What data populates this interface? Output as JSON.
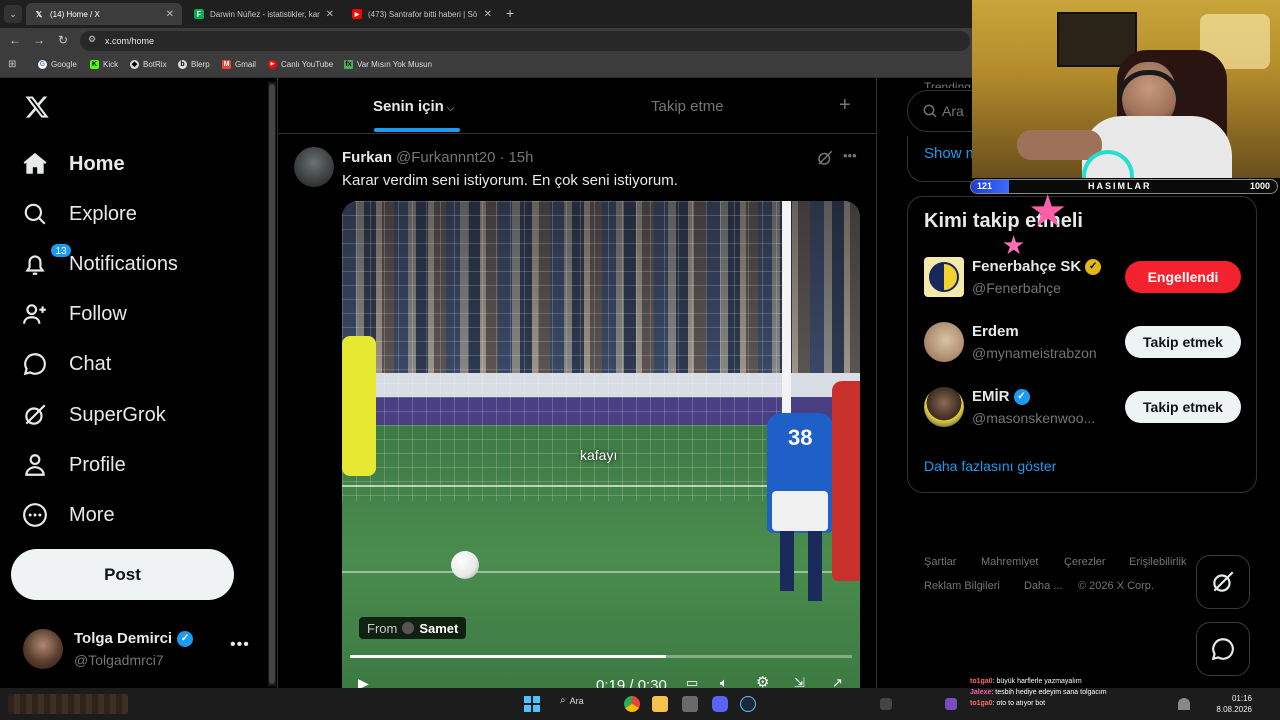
{
  "browser": {
    "tabs": [
      {
        "title": "(14) Home / X",
        "active": true
      },
      {
        "title": "Darwin Núñez - istatistikler, kar",
        "active": false
      },
      {
        "title": "(473) Santrafor bitti haberi | Sö",
        "active": false
      }
    ],
    "url": "x.com/home",
    "bookmarks": [
      "Google",
      "Kick",
      "BotRix",
      "Blerp",
      "Gmail",
      "Canlı YouTube",
      "Var Mısın Yok Musun"
    ]
  },
  "sidebar": {
    "items": [
      {
        "label": "Home",
        "icon": "home-icon"
      },
      {
        "label": "Explore",
        "icon": "search-icon"
      },
      {
        "label": "Notifications",
        "icon": "bell-icon",
        "badge": "13"
      },
      {
        "label": "Follow",
        "icon": "add-user-icon"
      },
      {
        "label": "Chat",
        "icon": "chat-icon"
      },
      {
        "label": "SuperGrok",
        "icon": "grok-icon"
      },
      {
        "label": "Profile",
        "icon": "person-icon"
      },
      {
        "label": "More",
        "icon": "more-circle-icon"
      }
    ],
    "post_label": "Post",
    "account": {
      "name": "Tolga Demirci",
      "handle": "@Tolgadmrci7"
    }
  },
  "feed": {
    "tabs": [
      "Senin için",
      "Takip etme"
    ],
    "post": {
      "author": "Furkan",
      "handle": "@Furkannnt20",
      "time": "15h",
      "text": "Karar verdim seni istiyorum. En çok seni istiyorum.",
      "video": {
        "from_label": "From",
        "from_name": "Samet",
        "overlay_text": "kafayı",
        "player_number": "38",
        "time": "0:19 / 0:30",
        "progress": 0.63
      }
    }
  },
  "right": {
    "search_placeholder": "Ara",
    "trending_partial": "Trending",
    "show_more_partial": "Show m",
    "who_to_follow_title": "Kimi takip etmeli",
    "suggestions": [
      {
        "name": "Fenerbahçe SK",
        "handle": "@Fenerbahçe",
        "verified": "gold",
        "button": "Engellendi"
      },
      {
        "name": "Erdem",
        "handle": "@mynameistrabzon",
        "verified": "",
        "button": "Takip etmek"
      },
      {
        "name": "EMİR",
        "handle": "@masonskenwoo...",
        "verified": "blue",
        "button": "Takip etmek"
      }
    ],
    "show_more": "Daha fazlasını göster",
    "footer": [
      "Şartlar",
      "Mahremiyet",
      "Çerezler",
      "Erişilebilirlik",
      "Reklam Bilgileri",
      "Daha ...",
      "© 2026 X Corp."
    ]
  },
  "stream": {
    "bar_left": "121",
    "bar_title": "HASIMLAR",
    "bar_right": "1000",
    "chat": [
      {
        "user": "to1ga0",
        "text": ": büyük harflerle yazmayalım"
      },
      {
        "user": "Jalexe",
        "text": ": tesbih hediye edeyim sana tolgacım"
      },
      {
        "user": "to1ga0",
        "text": ": oto to atıyor bot"
      }
    ]
  },
  "taskbar": {
    "search_label": "Ara",
    "time": "01:16",
    "date": "8.08.2026"
  },
  "colors": {
    "accent": "#1d9bf0",
    "blocked_red": "#f4212e",
    "gold": "#e2b719"
  }
}
